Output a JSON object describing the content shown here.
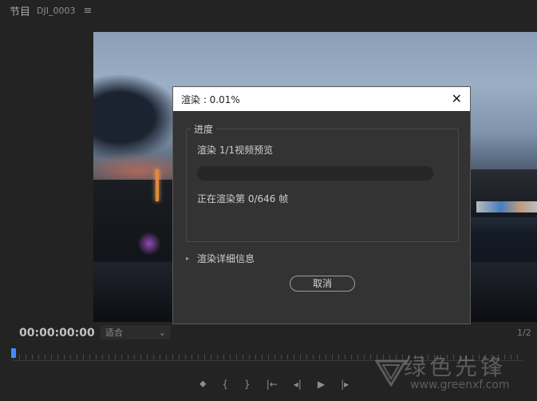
{
  "monitor": {
    "title": "节目",
    "sequence": "DJI_0003",
    "menu_icon": "≡"
  },
  "dialog": {
    "title": "渲染 : 0.01%",
    "close_icon": "✕",
    "group_label": "进度",
    "render_status": "渲染 1/1视频预览",
    "progress_fraction": 0.0001,
    "frame_status": "正在渲染第 0/646 帧",
    "details_label": "渲染详细信息",
    "cancel_label": "取消"
  },
  "transport": {
    "timecode": "00:00:00:00",
    "fit_label": "适合",
    "fit_caret": "⌄",
    "ratio": "1/2",
    "controls": [
      "⬥",
      "{",
      "}",
      "|←",
      "◂|",
      "▶",
      "|▸"
    ]
  },
  "watermark": {
    "text": "绿色先锋",
    "url": "www.greenxf.com"
  },
  "colors": {
    "accent": "#3a83d8",
    "dialog_bg": "#333333",
    "titlebar_bg": "#ffffff"
  }
}
